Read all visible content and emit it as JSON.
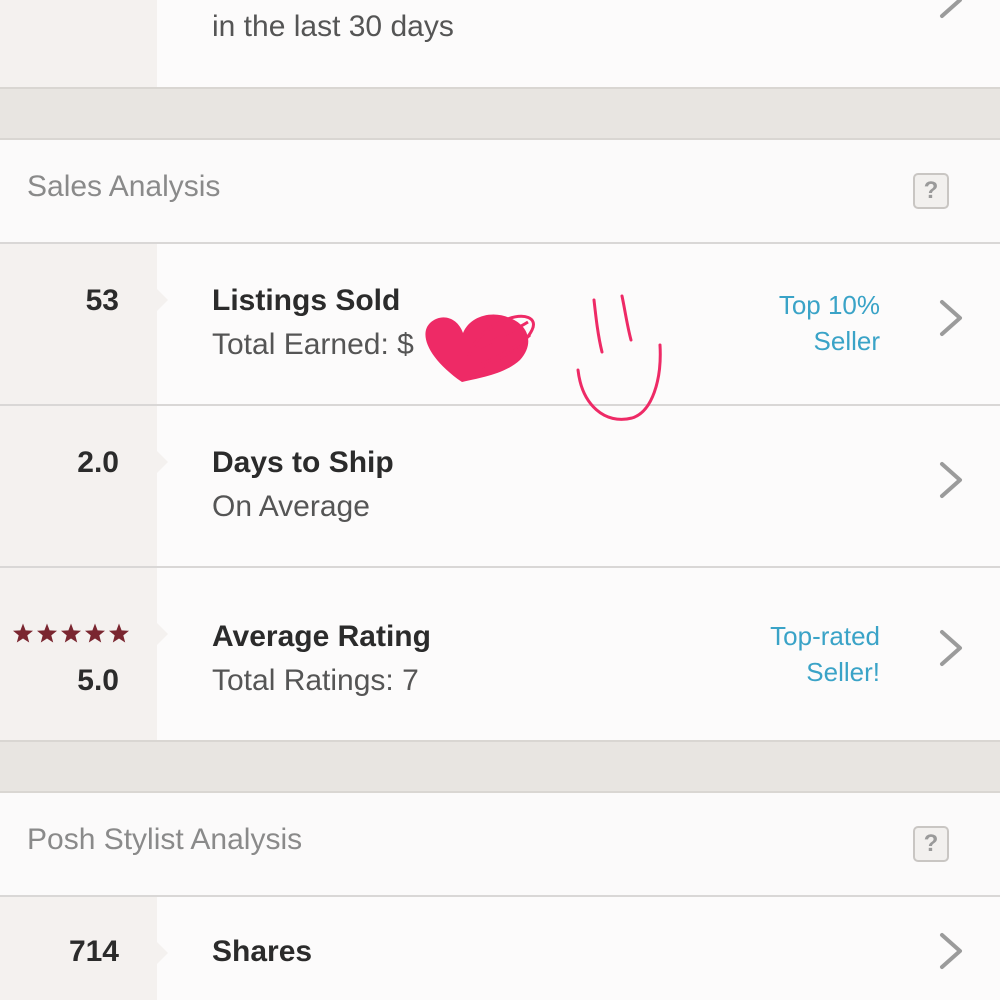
{
  "top_row": {
    "subtitle": "in the last 30 days"
  },
  "sales_analysis": {
    "title": "Sales Analysis",
    "help_label": "?",
    "rows": [
      {
        "value": "53",
        "title": "Listings Sold",
        "subtitle": "Total Earned: $",
        "badge_line1": "Top 10%",
        "badge_line2": "Seller",
        "icon": "chevron-right-icon"
      },
      {
        "value": "2.0",
        "title": "Days to Ship",
        "subtitle": "On Average",
        "icon": "chevron-right-icon"
      },
      {
        "value": "5.0",
        "stars": 5,
        "title": "Average Rating",
        "subtitle": "Total Ratings: 7",
        "badge_line1": "Top-rated",
        "badge_line2": "Seller!",
        "icon": "chevron-right-icon"
      }
    ]
  },
  "posh_stylist_analysis": {
    "title": "Posh Stylist Analysis",
    "help_label": "?",
    "rows": [
      {
        "value": "714",
        "title": "Shares",
        "icon": "chevron-right-icon"
      }
    ]
  },
  "colors": {
    "accent_link": "#3aa3c7",
    "star": "#7a2630",
    "doodle": "#ee2a66"
  }
}
